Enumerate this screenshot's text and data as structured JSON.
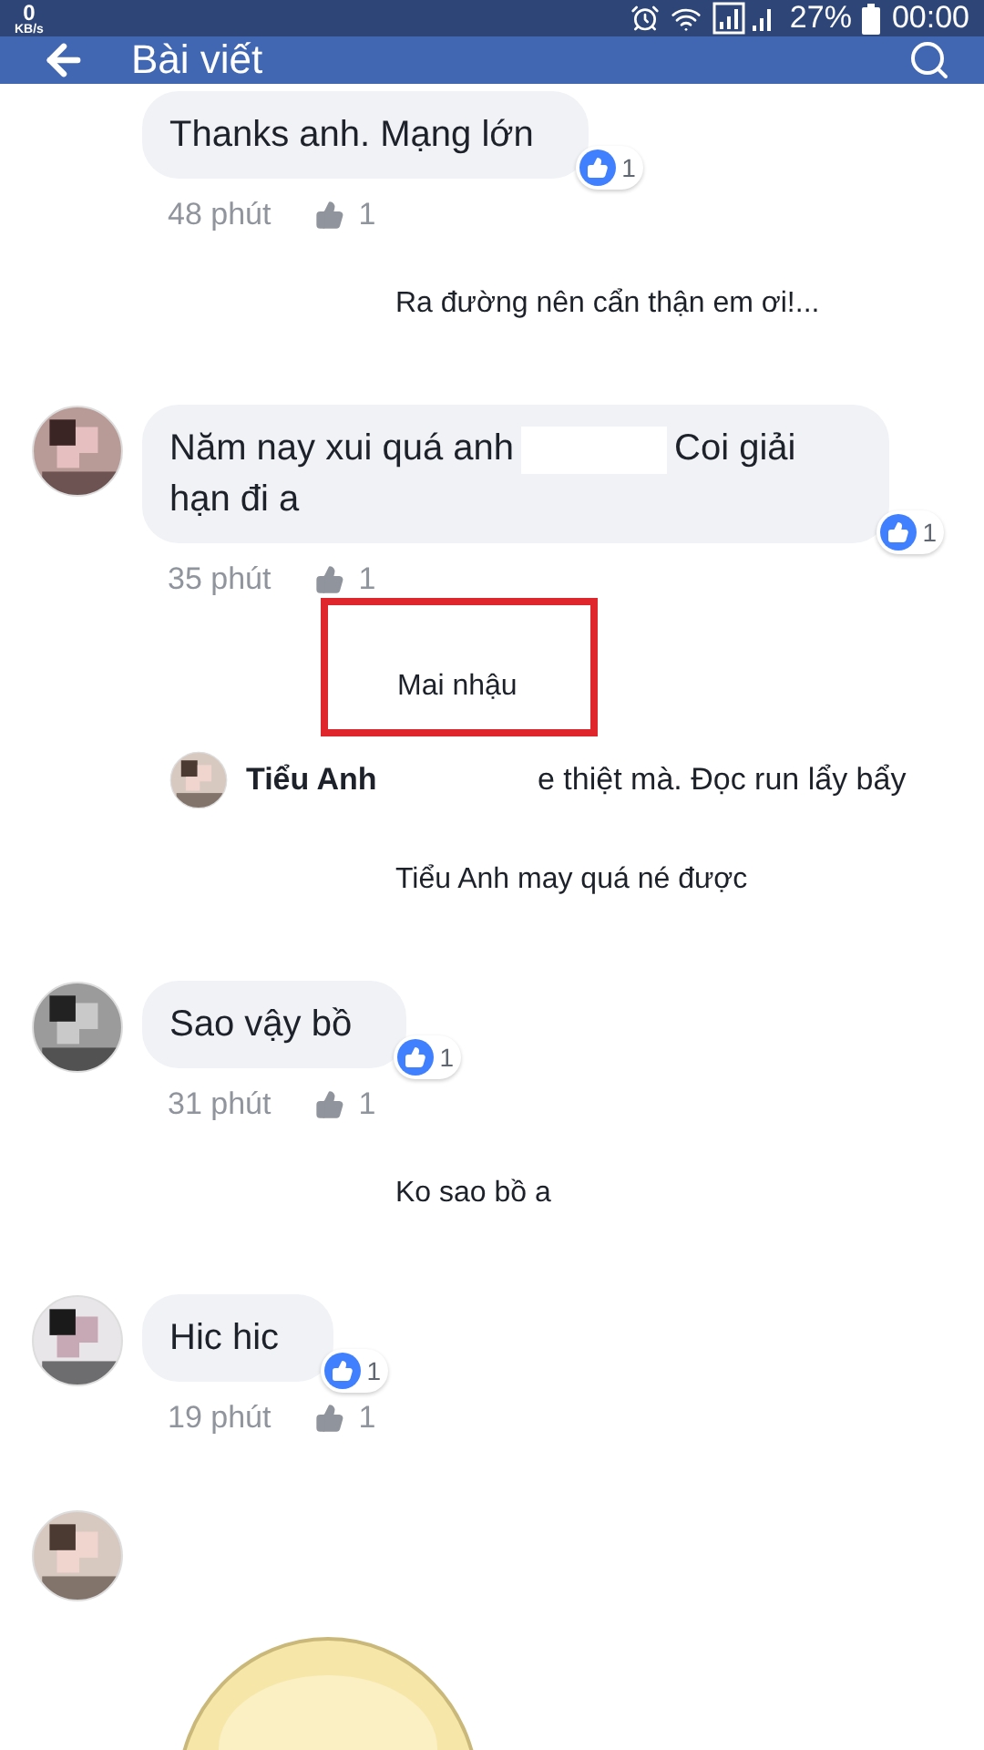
{
  "status_bar": {
    "speed": "0",
    "speed_unit": "KB/s",
    "battery": "27%",
    "time": "00:00"
  },
  "app_bar": {
    "title": "Bài viết"
  },
  "items": [
    {
      "kind": "comment",
      "avatar": false,
      "text_parts": [
        "Thanks anh. Mạng lớn"
      ],
      "time": "48 phút",
      "likes": "1",
      "reactions": "1"
    },
    {
      "kind": "caption",
      "text": "Ra đường nên cẩn thận em ơi!...",
      "boxed": false
    },
    {
      "kind": "comment",
      "avatar": true,
      "text_parts": [
        "Năm nay xui quá anh",
        "Coi giải hạn đi a"
      ],
      "time": "35 phút",
      "likes": "1",
      "reactions": "1"
    },
    {
      "kind": "caption",
      "text": "Mai nhậu",
      "boxed": true
    },
    {
      "kind": "reply",
      "name": "Tiểu Anh",
      "text": "e thiệt mà. Đọc run lẩy bẩy"
    },
    {
      "kind": "caption",
      "text": "Tiểu Anh  may quá né được",
      "boxed": false
    },
    {
      "kind": "comment",
      "avatar": true,
      "text_parts": [
        "Sao vậy bồ"
      ],
      "time": "31 phút",
      "likes": "1",
      "reactions": "1"
    },
    {
      "kind": "caption",
      "text": "Ko sao bồ a",
      "boxed": false
    },
    {
      "kind": "comment",
      "avatar": true,
      "text_parts": [
        "Hic hic"
      ],
      "time": "19 phút",
      "likes": "1",
      "reactions": "1"
    },
    {
      "kind": "sticker"
    }
  ]
}
